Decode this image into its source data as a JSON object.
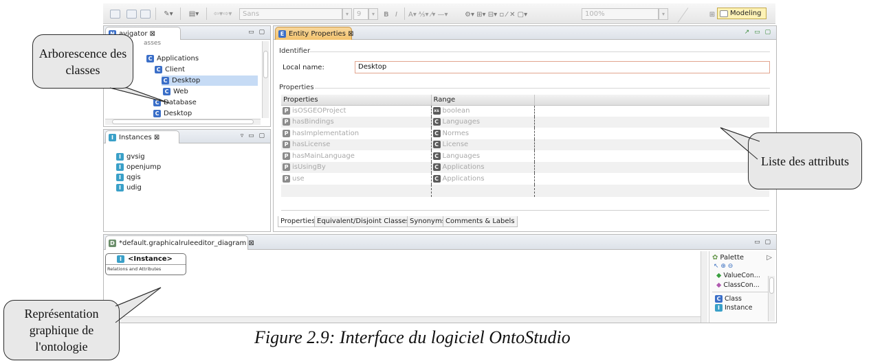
{
  "toolbar": {
    "font_value": "Sans",
    "font_size": "9",
    "bold": "B",
    "italic": "I",
    "zoom_value": "100%",
    "perspective_label": "Modeling"
  },
  "navigator": {
    "tab_label": "Navigator ⊠",
    "tab_visible": "avigator ⊠",
    "items": [
      {
        "label": "asses",
        "icon": "folder-icon"
      },
      {
        "label": "Applications",
        "icon": "class-icon"
      },
      {
        "label": "Client",
        "icon": "class-icon"
      },
      {
        "label": "Desktop",
        "icon": "class-icon"
      },
      {
        "label": "Web",
        "icon": "class-icon"
      },
      {
        "label": "Database",
        "icon": "class-icon"
      },
      {
        "label": "Desktop",
        "icon": "class-icon"
      }
    ]
  },
  "instances": {
    "tab_label": "Instances ⊠",
    "items": [
      "gvsig",
      "openjump",
      "qgis",
      "udig"
    ]
  },
  "entity_properties": {
    "tab_label": "Entity Properties ⊠",
    "identifier_label": "Identifier",
    "local_name_label": "Local name:",
    "local_name_value": "Desktop",
    "properties_label": "Properties",
    "columns": [
      "Properties",
      "Range"
    ],
    "rows": [
      {
        "property": "isOSGEOProject",
        "range": "boolean",
        "range_icon": "xsd"
      },
      {
        "property": "hasBindings",
        "range": "Languages",
        "range_icon": "C"
      },
      {
        "property": "hasImplementation",
        "range": "Normes",
        "range_icon": "C"
      },
      {
        "property": "hasLicense",
        "range": "License",
        "range_icon": "C"
      },
      {
        "property": "hasMainLanguage",
        "range": "Languages",
        "range_icon": "C"
      },
      {
        "property": "isUsingBy",
        "range": "Applications",
        "range_icon": "C"
      },
      {
        "property": "use",
        "range": "Applications",
        "range_icon": "C"
      }
    ],
    "sub_tabs": [
      "Properties",
      "Equivalent/Disjoint Classes",
      "Synonyms",
      "Comments & Labels"
    ]
  },
  "diagram": {
    "tab_label": "*default.graphicalruleeditor_diagram ⊠",
    "node_title": "<Instance>",
    "node_subtitle": "Relations and Attributes"
  },
  "palette": {
    "title": "Palette",
    "items": [
      "ValueCon...",
      "ClassCon...",
      "Class",
      "Instance"
    ]
  },
  "callouts": {
    "tree": "Arborescence des classes",
    "attributes": "Liste des attributs",
    "graphic": "Représentation graphique de l'ontologie"
  },
  "caption": "Figure 2.9: Interface du logiciel OntoStudio"
}
